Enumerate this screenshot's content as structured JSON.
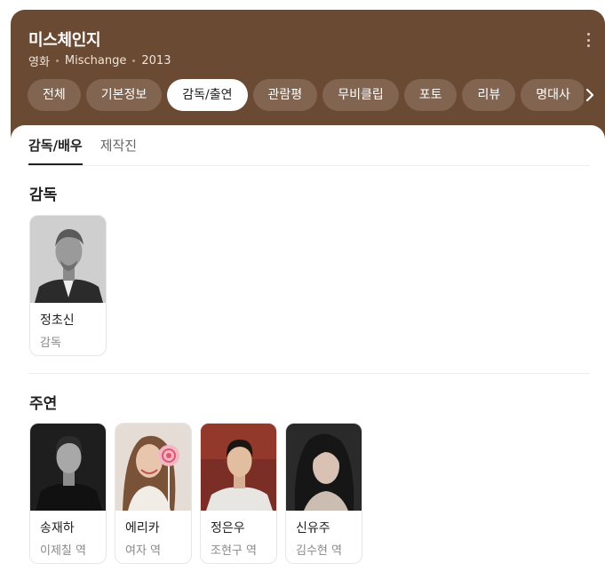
{
  "header": {
    "title": "미스체인지",
    "category": "영화",
    "original_title": "Mischange",
    "year": "2013"
  },
  "tabs": [
    "전체",
    "기본정보",
    "감독/출연",
    "관람평",
    "무비클립",
    "포토",
    "리뷰",
    "명대사"
  ],
  "active_tab": "감독/출연",
  "subtabs": [
    "감독/배우",
    "제작진"
  ],
  "active_subtab": "감독/배우",
  "sections": {
    "director": {
      "title": "감독",
      "people": [
        {
          "name": "정초신",
          "role": "감독"
        }
      ]
    },
    "cast": {
      "title": "주연",
      "people": [
        {
          "name": "송재하",
          "role": "이제칠 역"
        },
        {
          "name": "에리카",
          "role": "여자 역"
        },
        {
          "name": "정은우",
          "role": "조현구 역"
        },
        {
          "name": "신유주",
          "role": "김수현 역"
        }
      ]
    }
  },
  "colors": {
    "header_bg": "#6b4a33",
    "active_tab_bg": "#ffffff"
  },
  "icons": [
    "more-vertical-icon",
    "chevron-right-icon"
  ]
}
